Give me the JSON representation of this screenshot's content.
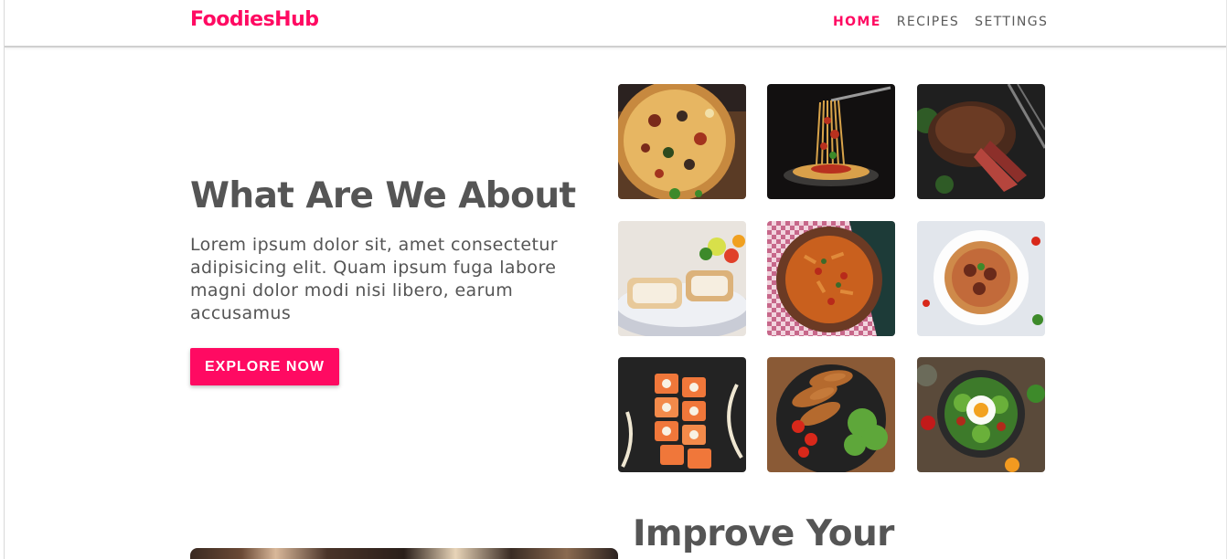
{
  "brand": {
    "name": "FoodiesHub",
    "accent": "#ff0a62"
  },
  "nav": {
    "items": [
      {
        "label": "HOME",
        "active": true
      },
      {
        "label": "RECIPES",
        "active": false
      },
      {
        "label": "SETTINGS",
        "active": false
      }
    ]
  },
  "hero": {
    "title": "What Are We About",
    "text": "Lorem ipsum dolor sit, amet consectetur adipisicing elit. Quam ipsum fuga labore magni dolor modi nisi libero, earum accusamus",
    "cta_label": "EXPLORE NOW"
  },
  "gallery": {
    "items": [
      "pizza-image",
      "spaghetti-fork-image",
      "steak-image",
      "fish-fillet-image",
      "pasta-bowl-image",
      "meatball-spaghetti-image",
      "sushi-rolls-image",
      "fried-chicken-image",
      "salad-egg-image"
    ]
  },
  "next_section": {
    "title": "Improve Your"
  },
  "colors": {
    "text": "#555555",
    "accent": "#ff0a62",
    "background": "#ffffff"
  }
}
